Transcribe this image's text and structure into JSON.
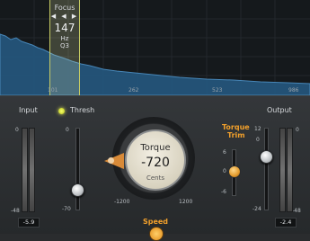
{
  "display": {
    "focus": {
      "title": "Focus",
      "arrows": "◀ ◀ ▶",
      "value": "147",
      "unit": "Hz",
      "q_label": "Q3"
    },
    "freq_labels": [
      "101",
      "262",
      "523",
      "986"
    ],
    "colors": {
      "band": "#c7cc64",
      "spectrum": "#2f6b98"
    }
  },
  "input": {
    "label": "Input",
    "scale": [
      "0",
      "-48"
    ],
    "readout": "-5.9"
  },
  "thresh": {
    "label": "Thresh",
    "scale": [
      "0",
      "-70"
    ],
    "led_color": "#e7f05a"
  },
  "torque": {
    "title": "Torque",
    "value": "-720",
    "unit": "Cents",
    "min_label": "-1200",
    "max_label": "1200"
  },
  "torque_trim": {
    "label_line1": "Torque",
    "label_line2": "Trim",
    "scale": [
      "6",
      "0",
      "-6"
    ],
    "accent": "#f2a02b"
  },
  "output": {
    "label": "Output",
    "scale_left": [
      "12",
      "0",
      "-24"
    ],
    "scale_right": [
      "0",
      "-48"
    ],
    "readout": "-2.4"
  },
  "speed": {
    "label": "Speed"
  }
}
